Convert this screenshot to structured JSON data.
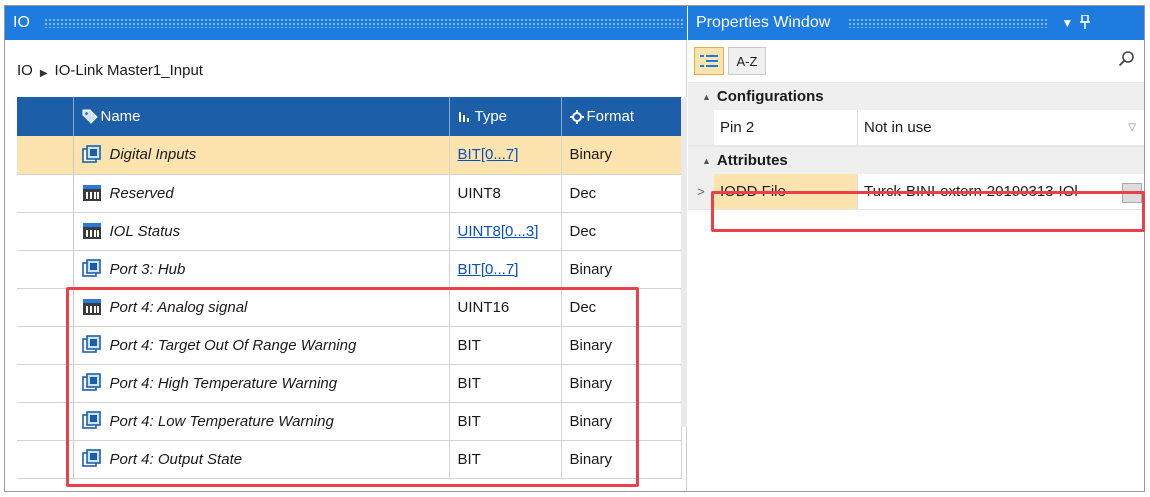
{
  "io_panel": {
    "title": "IO",
    "breadcrumb": {
      "root": "IO",
      "current": "IO-Link Master1_Input"
    },
    "columns": {
      "name": "Name",
      "type": "Type",
      "format": "Format"
    },
    "rows": [
      {
        "name": "Digital Inputs",
        "type": "BIT[0...7]",
        "format": "Binary",
        "icon": "bit-io-icon",
        "type_link": true,
        "selected": true
      },
      {
        "name": "Reserved",
        "type": "UINT8",
        "format": "Dec",
        "icon": "numeric-io-icon",
        "type_link": false,
        "selected": false
      },
      {
        "name": "IOL Status",
        "type": "UINT8[0...3]",
        "format": "Dec",
        "icon": "numeric-io-icon",
        "type_link": true,
        "selected": false
      },
      {
        "name": "Port 3: Hub",
        "type": "BIT[0...7]",
        "format": "Binary",
        "icon": "bit-io-icon",
        "type_link": true,
        "selected": false
      },
      {
        "name": "Port 4: Analog signal",
        "type": "UINT16",
        "format": "Dec",
        "icon": "numeric-io-icon",
        "type_link": false,
        "selected": false
      },
      {
        "name": "Port 4: Target Out Of Range Warning",
        "type": "BIT",
        "format": "Binary",
        "icon": "bit-io-icon",
        "type_link": false,
        "selected": false
      },
      {
        "name": "Port 4: High Temperature Warning",
        "type": "BIT",
        "format": "Binary",
        "icon": "bit-io-icon",
        "type_link": false,
        "selected": false
      },
      {
        "name": "Port 4: Low Temperature Warning",
        "type": "BIT",
        "format": "Binary",
        "icon": "bit-io-icon",
        "type_link": false,
        "selected": false
      },
      {
        "name": "Port 4: Output State",
        "type": "BIT",
        "format": "Binary",
        "icon": "bit-io-icon",
        "type_link": false,
        "selected": false
      }
    ]
  },
  "properties": {
    "title": "Properties Window",
    "toolbar": {
      "categorized_icon": "categorized-icon",
      "az_label": "A-Z",
      "search_icon": "search-icon"
    },
    "categories": [
      {
        "label": "Configurations",
        "items": [
          {
            "name": "Pin 2",
            "value": "Not in use",
            "control": "dropdown"
          }
        ]
      },
      {
        "label": "Attributes",
        "items": [
          {
            "name": "IODD File",
            "value": "Turck-BINI-extern-20190313-IOl",
            "control": "ellipsis"
          }
        ]
      }
    ]
  },
  "colors": {
    "title_bar": "#1e7ce0",
    "grid_header": "#1c5fa8",
    "selection": "#fde4ae",
    "highlight_box": "#e8414a",
    "link": "#0a4fc2"
  }
}
